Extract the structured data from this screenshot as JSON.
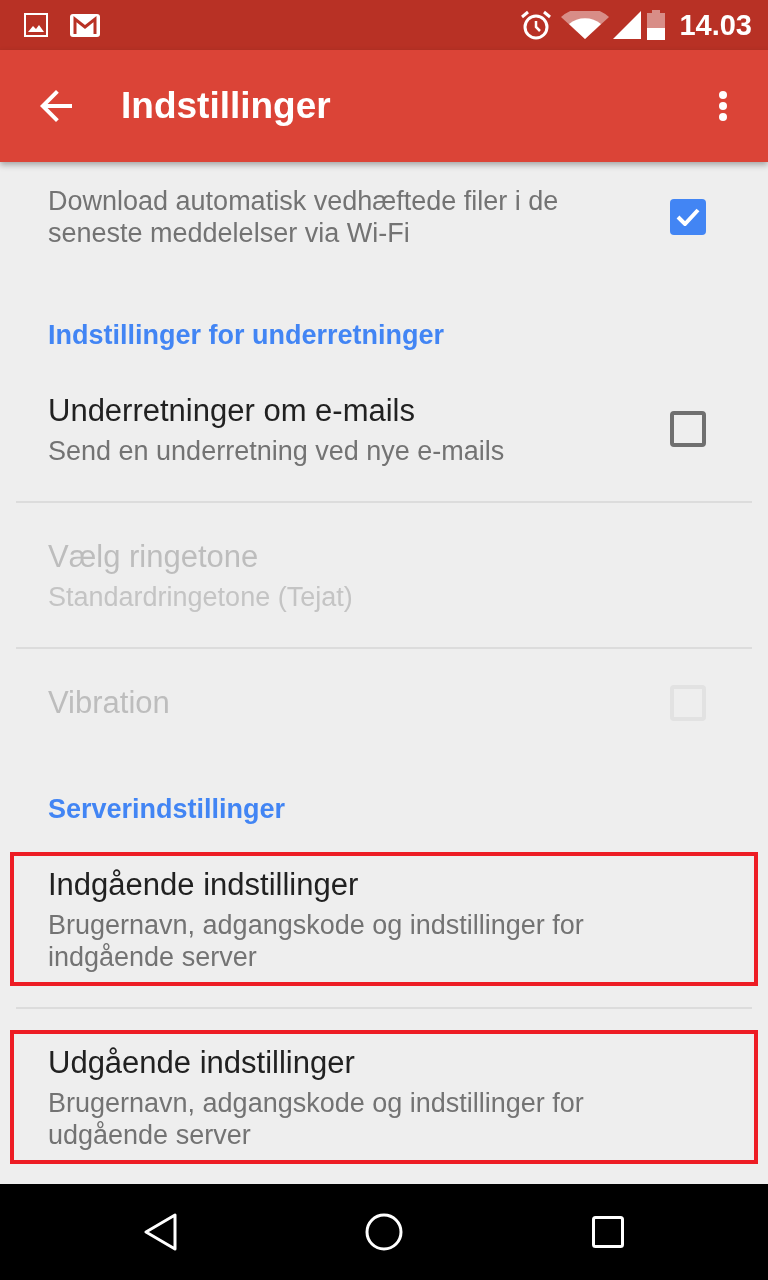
{
  "status_bar": {
    "time": "14.03"
  },
  "app_bar": {
    "title": "Indstillinger"
  },
  "sections": [
    {
      "items": [
        {
          "kind": "checkbox",
          "summary": "Download automatisk vedhæftede filer i de seneste meddelelser via Wi-Fi",
          "checked": true,
          "disabled": false,
          "highlighted": false
        }
      ]
    },
    {
      "header": "Indstillinger for underretninger",
      "items": [
        {
          "kind": "checkbox",
          "title": "Underretninger om e-mails",
          "summary": "Send en underretning ved nye e-mails",
          "checked": false,
          "disabled": false,
          "highlighted": false
        },
        {
          "kind": "plain",
          "title": "Vælg ringetone",
          "summary": "Standardringetone (Tejat)",
          "disabled": true,
          "highlighted": false
        },
        {
          "kind": "checkbox",
          "title": "Vibration",
          "checked": false,
          "disabled": true,
          "highlighted": false
        }
      ]
    },
    {
      "header": "Serverindstillinger",
      "items": [
        {
          "kind": "plain",
          "title": "Indgående indstillinger",
          "summary": "Brugernavn, adgangskode og indstillinger for indgående server",
          "disabled": false,
          "highlighted": true
        },
        {
          "kind": "plain",
          "title": "Udgående indstillinger",
          "summary": "Brugernavn, adgangskode og indstillinger for udgående server",
          "disabled": false,
          "highlighted": true
        }
      ]
    }
  ]
}
